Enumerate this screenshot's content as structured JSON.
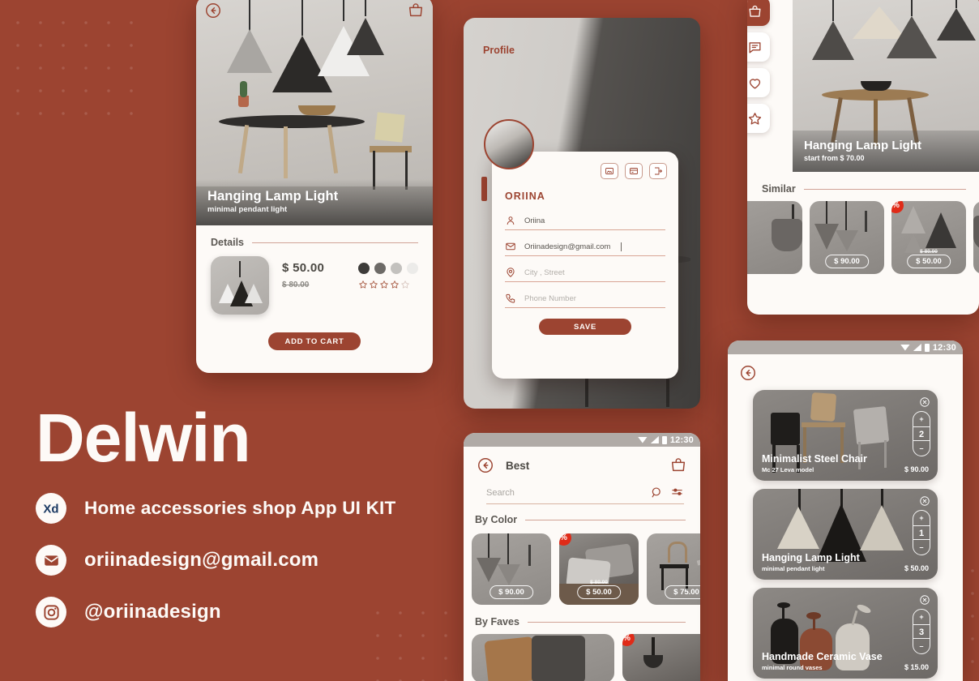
{
  "background": {
    "color": "#9c4431",
    "accent": "#9c4431",
    "card": "#fdfaf7"
  },
  "brand": {
    "title": "Delwin",
    "tagline": "Home accessories shop App UI KIT",
    "email": "oriinadesign@gmail.com",
    "instagram": "@oriinadesign",
    "icons": {
      "xd": "adobe-xd-icon",
      "mail": "mail-icon",
      "instagram": "instagram-icon"
    }
  },
  "status_bar": {
    "time": "12:30",
    "icons": [
      "wifi-icon",
      "signal-icon",
      "battery-icon"
    ]
  },
  "detail_screen": {
    "back_icon": "back-arrow-icon",
    "bag_icon": "shopping-bag-icon",
    "hero_title": "Hanging Lamp Light",
    "hero_subtitle": "minimal pendant light",
    "section_label": "Details",
    "price": "$ 50.00",
    "old_price": "$ 80.00",
    "swatches": [
      "#3d3b39",
      "#6d6a67",
      "#c3c1be",
      "#ecebe9"
    ],
    "rating_filled": 4,
    "rating_total": 5,
    "add_to_cart_label": "ADD TO CART"
  },
  "profile_screen": {
    "header_label": "Profile",
    "name": "ORIINA",
    "actions": [
      "edit-photo-icon",
      "payment-card-icon",
      "logout-icon"
    ],
    "fields": [
      {
        "icon": "user-icon",
        "value": "Oriina",
        "is_placeholder": false
      },
      {
        "icon": "mail-icon",
        "value": "Oriinadesign@gmail.com",
        "is_placeholder": false,
        "has_caret": true
      },
      {
        "icon": "pin-icon",
        "value": "City , Street",
        "is_placeholder": true
      },
      {
        "icon": "phone-icon",
        "value": "Phone Number",
        "is_placeholder": true
      }
    ],
    "save_label": "SAVE"
  },
  "best_screen": {
    "back_icon": "back-arrow-icon",
    "title": "Best",
    "bag_icon": "shopping-bag-icon",
    "search_placeholder": "Search",
    "search_icon": "search-icon",
    "filter_icon": "filter-icon",
    "sections": [
      {
        "label": "By Color",
        "items": [
          {
            "price": "$ 90.00",
            "old_price": null,
            "discount": false,
            "kind": "lamps"
          },
          {
            "price": "$ 50.00",
            "old_price": "$ 80.00",
            "discount": true,
            "kind": "pillow"
          },
          {
            "price": "$ 75.00",
            "old_price": null,
            "discount": false,
            "kind": "chair"
          }
        ]
      },
      {
        "label": "By Faves",
        "items": [
          {
            "price": null,
            "old_price": null,
            "discount": false,
            "kind": "pillow"
          },
          {
            "price": null,
            "old_price": null,
            "discount": true,
            "kind": "vase"
          }
        ]
      }
    ]
  },
  "similar_screen": {
    "rail": [
      {
        "icon": "shopping-bag-icon",
        "active": true
      },
      {
        "icon": "chat-icon",
        "active": false
      },
      {
        "icon": "heart-icon",
        "active": false
      },
      {
        "icon": "star-icon",
        "active": false
      }
    ],
    "hero_title": "Hanging Lamp Light",
    "hero_subtitle": "start from $ 70.00",
    "section_label": "Similar",
    "items": [
      {
        "price": null,
        "old_price": null,
        "discount": false,
        "kind": "lamp-partial"
      },
      {
        "price": "$ 90.00",
        "old_price": null,
        "discount": false,
        "kind": "lamps"
      },
      {
        "price": "$ 50.00",
        "old_price": "$ 80.00",
        "discount": true,
        "kind": "cones"
      },
      {
        "price": "$",
        "old_price": null,
        "discount": false,
        "kind": "lamp-partial"
      }
    ]
  },
  "cart_screen": {
    "back_icon": "back-arrow-icon",
    "items": [
      {
        "title": "Minimalist Steel Chair",
        "subtitle": "Mc 27 Leva model",
        "price": "$ 90.00",
        "qty": "2",
        "close_icon": "close-circle-icon",
        "plus": "+",
        "minus": "–"
      },
      {
        "title": "Hanging Lamp Light",
        "subtitle": "minimal pendant light",
        "price": "$ 50.00",
        "qty": "1",
        "close_icon": "close-circle-icon",
        "plus": "+",
        "minus": "–"
      },
      {
        "title": "Handmade Ceramic Vase",
        "subtitle": "minimal round vases",
        "price": "$ 15.00",
        "qty": "3",
        "close_icon": "close-circle-icon",
        "plus": "+",
        "minus": "–"
      }
    ]
  }
}
